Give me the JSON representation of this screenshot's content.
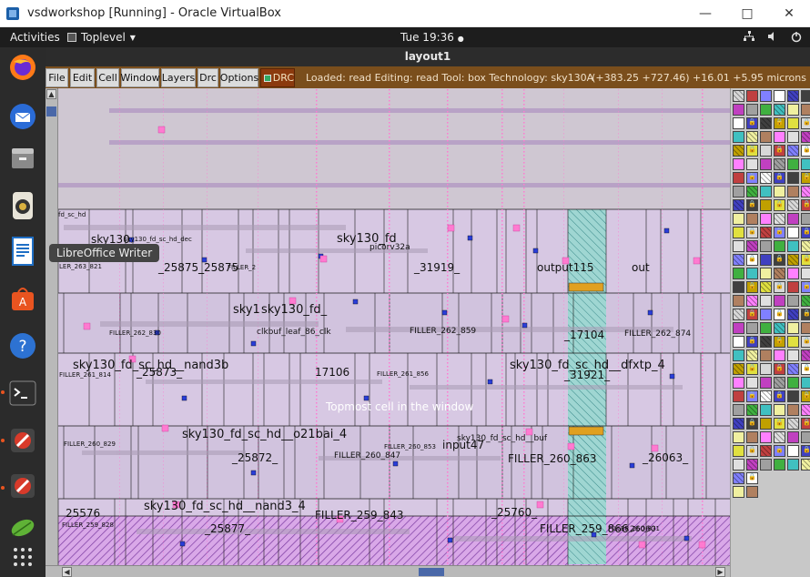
{
  "host_window": {
    "title": "vsdworkshop [Running] - Oracle VirtualBox",
    "minimize_icon": "minimize-icon",
    "maximize_icon": "maximize-icon",
    "close_icon": "close-icon"
  },
  "topbar": {
    "activities": "Activities",
    "app_name": "Toplevel",
    "clock": "Tue 19:36"
  },
  "dock": {
    "items": [
      "firefox-icon",
      "thunderbird-icon",
      "files-icon",
      "rhythmbox-icon",
      "libreoffice-writer-icon",
      "app-center-icon",
      "help-icon",
      "terminal-icon",
      "blocked-app-icon",
      "blocked-app-icon",
      "leaf-app-icon",
      "show-apps-icon"
    ],
    "tooltip": "LibreOffice Writer"
  },
  "layout_window": {
    "title": "layout1",
    "menu": [
      "File",
      "Edit",
      "Cell",
      "Window",
      "Layers",
      "Drc",
      "Options"
    ],
    "drc_label": "DRC",
    "status": "Loaded: read  Editing: read  Tool: box   Technology: sky130A",
    "coords": "(+383.25 +727.46) +16.01 +5.95 microns"
  },
  "canvas": {
    "overlay_text": "Topmost cell in the window",
    "labels": [
      {
        "t": "fd_sc_hd",
        "c": "small"
      },
      {
        "t": "sky130",
        "c": "big"
      },
      {
        "t": "sky130_fd_sc_hd_dec",
        "c": "small"
      },
      {
        "t": "sky130_fd",
        "c": "huge"
      },
      {
        "t": "picorv32a",
        "c": "med"
      },
      {
        "t": "LER_263_821",
        "c": "small"
      },
      {
        "t": "_25875_",
        "c": "big"
      },
      {
        "t": "_25875",
        "c": "big"
      },
      {
        "t": "FILLER_2",
        "c": "small"
      },
      {
        "t": "_31919_",
        "c": "big"
      },
      {
        "t": "output115",
        "c": "big"
      },
      {
        "t": "out",
        "c": "big"
      },
      {
        "t": "sky1",
        "c": "huge"
      },
      {
        "t": "sky130_fd_",
        "c": "huge"
      },
      {
        "t": "clkbuf_leaf_86_clk",
        "c": "med"
      },
      {
        "t": "FILLER_262_830",
        "c": "small"
      },
      {
        "t": "FILLER_262_859",
        "c": "med"
      },
      {
        "t": "_17104",
        "c": "big"
      },
      {
        "t": "FILLER_262_874",
        "c": "med"
      },
      {
        "t": "sky130_fd_sc_hd__nand3b",
        "c": "huge"
      },
      {
        "t": "_25873_",
        "c": "big"
      },
      {
        "t": "17106",
        "c": "big"
      },
      {
        "t": "sky130_fd_sc_hd__dfxtp_4",
        "c": "huge"
      },
      {
        "t": "_31921_",
        "c": "big"
      },
      {
        "t": "FILLER_261_814",
        "c": "small"
      },
      {
        "t": "FILLER_261_856",
        "c": "small"
      },
      {
        "t": "sky130_fd_sc_hd__o21bai_4",
        "c": "huge"
      },
      {
        "t": "_25872_",
        "c": "big"
      },
      {
        "t": "FILLER_260_847",
        "c": "med"
      },
      {
        "t": "input47",
        "c": "big"
      },
      {
        "t": "FILLER_260_863",
        "c": "big"
      },
      {
        "t": "_26063_",
        "c": "big"
      },
      {
        "t": "FILLER_260_829",
        "c": "small"
      },
      {
        "t": "FILLER_260_853",
        "c": "small"
      },
      {
        "t": "sky130_fd_sc_hd__nand3_4",
        "c": "huge"
      },
      {
        "t": "25576",
        "c": "big"
      },
      {
        "t": "_25877_",
        "c": "big"
      },
      {
        "t": "FILLER_259_843",
        "c": "big"
      },
      {
        "t": "_25760_",
        "c": "big"
      },
      {
        "t": "FILLER_259_866",
        "c": "big"
      },
      {
        "t": "26060",
        "c": "med"
      },
      {
        "t": "sky130_fd_sc_hd__buf",
        "c": "med"
      },
      {
        "t": "FILLER_259_828",
        "c": "small"
      },
      {
        "t": "FILLER_260_871",
        "c": "small"
      }
    ]
  },
  "palette": {
    "colors": [
      "#d8d8d8",
      "#f0f0a0",
      "#ffffff",
      "#e0e0e0",
      "#c0a000",
      "#40b040",
      "#c04040",
      "#b08060",
      "#4040c0",
      "#c040c0",
      "#e0e040",
      "#40c0c0",
      "#8080ff",
      "#ff80ff",
      "#404040",
      "#a0a0a0"
    ]
  }
}
